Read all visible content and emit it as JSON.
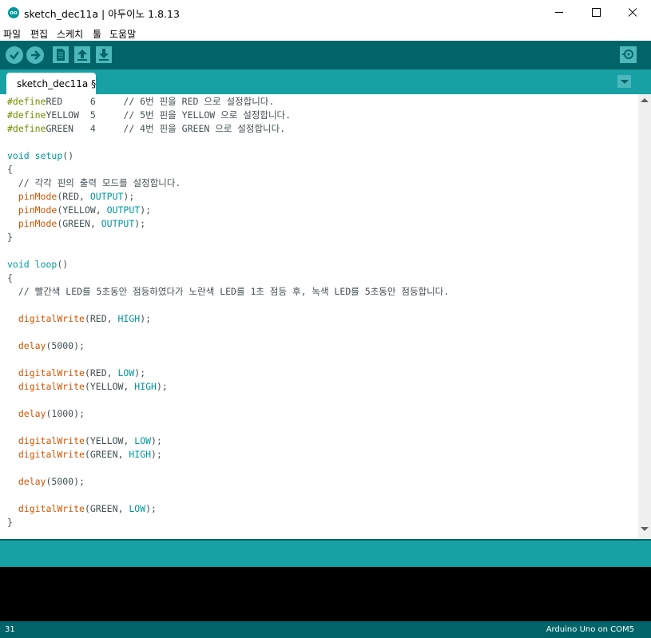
{
  "window": {
    "title": "sketch_dec11a | 아두이노 1.8.13",
    "logo_text": "oo"
  },
  "menu": [
    "파일",
    "편집",
    "스케치",
    "툴",
    "도움말"
  ],
  "toolbar": {
    "buttons": [
      {
        "name": "verify",
        "icon": "check-icon"
      },
      {
        "name": "upload",
        "icon": "arrow-right-icon"
      },
      {
        "name": "new",
        "icon": "new-file-icon"
      },
      {
        "name": "open",
        "icon": "arrow-up-icon"
      },
      {
        "name": "save",
        "icon": "arrow-down-icon"
      }
    ],
    "serial_monitor_icon": "magnifier-icon"
  },
  "tab": {
    "label": "sketch_dec11a §"
  },
  "code": [
    [
      [
        "pp",
        "#define"
      ],
      [
        "",
        "RED     6     "
      ],
      [
        "cm",
        "// 6번 핀을 RED 으로 설정합니다."
      ]
    ],
    [
      [
        "pp",
        "#define"
      ],
      [
        "",
        "YELLOW  5     "
      ],
      [
        "cm",
        "// 5번 핀을 YELLOW 으로 설정합니다."
      ]
    ],
    [
      [
        "pp",
        "#define"
      ],
      [
        "",
        "GREEN   4     "
      ],
      [
        "cm",
        "// 4번 핀을 GREEN 으로 설정합니다."
      ]
    ],
    [],
    [
      [
        "kw",
        "void"
      ],
      [
        "",
        " "
      ],
      [
        "kw",
        "setup"
      ],
      [
        "",
        "()"
      ]
    ],
    [
      [
        "",
        "{"
      ]
    ],
    [
      [
        "cm",
        "  // 각각 핀의 출력 모드를 설정합니다."
      ]
    ],
    [
      [
        "",
        "  "
      ],
      [
        "fn",
        "pinMode"
      ],
      [
        "",
        "(RED, "
      ],
      [
        "cst",
        "OUTPUT"
      ],
      [
        "",
        ");"
      ]
    ],
    [
      [
        "",
        "  "
      ],
      [
        "fn",
        "pinMode"
      ],
      [
        "",
        "(YELLOW, "
      ],
      [
        "cst",
        "OUTPUT"
      ],
      [
        "",
        ");"
      ]
    ],
    [
      [
        "",
        "  "
      ],
      [
        "fn",
        "pinMode"
      ],
      [
        "",
        "(GREEN, "
      ],
      [
        "cst",
        "OUTPUT"
      ],
      [
        "",
        ");"
      ]
    ],
    [
      [
        "",
        "}"
      ]
    ],
    [],
    [
      [
        "kw",
        "void"
      ],
      [
        "",
        " "
      ],
      [
        "kw",
        "loop"
      ],
      [
        "",
        "()"
      ]
    ],
    [
      [
        "",
        "{"
      ]
    ],
    [
      [
        "cm",
        "  // 빨간색 LED를 5초동안 점등하였다가 노란색 LED를 1초 점등 후, 녹색 LED를 5초동안 점등합니다."
      ]
    ],
    [],
    [
      [
        "",
        "  "
      ],
      [
        "fn",
        "digitalWrite"
      ],
      [
        "",
        "(RED, "
      ],
      [
        "cst",
        "HIGH"
      ],
      [
        "",
        ");"
      ]
    ],
    [],
    [
      [
        "",
        "  "
      ],
      [
        "fn",
        "delay"
      ],
      [
        "",
        "(5000);"
      ]
    ],
    [],
    [
      [
        "",
        "  "
      ],
      [
        "fn",
        "digitalWrite"
      ],
      [
        "",
        "(RED, "
      ],
      [
        "cst",
        "LOW"
      ],
      [
        "",
        ");"
      ]
    ],
    [
      [
        "",
        "  "
      ],
      [
        "fn",
        "digitalWrite"
      ],
      [
        "",
        "(YELLOW, "
      ],
      [
        "cst",
        "HIGH"
      ],
      [
        "",
        ");"
      ]
    ],
    [],
    [
      [
        "",
        "  "
      ],
      [
        "fn",
        "delay"
      ],
      [
        "",
        "(1000);"
      ]
    ],
    [],
    [
      [
        "",
        "  "
      ],
      [
        "fn",
        "digitalWrite"
      ],
      [
        "",
        "(YELLOW, "
      ],
      [
        "cst",
        "LOW"
      ],
      [
        "",
        ");"
      ]
    ],
    [
      [
        "",
        "  "
      ],
      [
        "fn",
        "digitalWrite"
      ],
      [
        "",
        "(GREEN, "
      ],
      [
        "cst",
        "HIGH"
      ],
      [
        "",
        ");"
      ]
    ],
    [],
    [
      [
        "",
        "  "
      ],
      [
        "fn",
        "delay"
      ],
      [
        "",
        "(5000);"
      ]
    ],
    [],
    [
      [
        "",
        "  "
      ],
      [
        "fn",
        "digitalWrite"
      ],
      [
        "",
        "(GREEN, "
      ],
      [
        "cst",
        "LOW"
      ],
      [
        "",
        ");"
      ]
    ],
    [
      [
        "",
        "}"
      ]
    ]
  ],
  "footer": {
    "line_number": "31",
    "board": "Arduino Uno on COM5"
  },
  "colors": {
    "toolbar": "#006468",
    "tabbar": "#17a1a5",
    "button": "#4db7bb",
    "keyword": "#00979c",
    "function": "#d35400",
    "preprocessor": "#728e00"
  }
}
